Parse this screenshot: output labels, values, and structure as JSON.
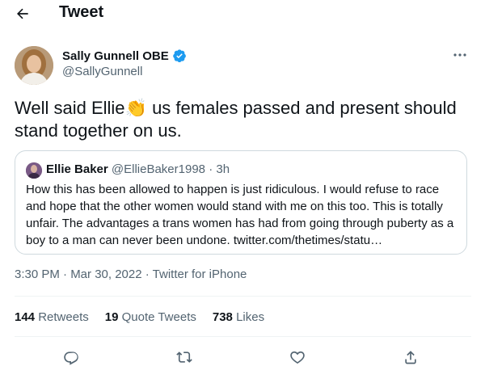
{
  "header": {
    "title": "Tweet",
    "back_icon": "back-arrow-icon"
  },
  "tweet": {
    "author_name": "Sally Gunnell OBE",
    "author_handle": "@SallyGunnell",
    "text_before_emoji": "Well said Ellie",
    "emoji": "👏",
    "text_after_emoji": " us females passed and present should stand together on us.",
    "timestamp": "3:30 PM · Mar 30, 2022",
    "separator": " · ",
    "source": "Twitter for iPhone"
  },
  "quote": {
    "author_name": "Ellie Baker",
    "author_handle": "@EllieBaker1998",
    "time": " · 3h",
    "text": "How this has been allowed to happen is just ridiculous. I would refuse to race and hope that the other women would stand with me on this too. This is totally unfair. The advantages a trans women has had from going through puberty as a boy to a man can never been undone. twitter.com/thetimes/statu…"
  },
  "stats": {
    "retweets_count": "144",
    "retweets_label": "Retweets",
    "quotes_count": "19",
    "quotes_label": "Quote Tweets",
    "likes_count": "738",
    "likes_label": "Likes"
  },
  "colors": {
    "verified": "#1d9bf0",
    "secondary_text": "#536471",
    "border": "#cfd9de"
  },
  "actions": [
    "reply-icon",
    "retweet-icon",
    "like-icon",
    "share-icon"
  ]
}
